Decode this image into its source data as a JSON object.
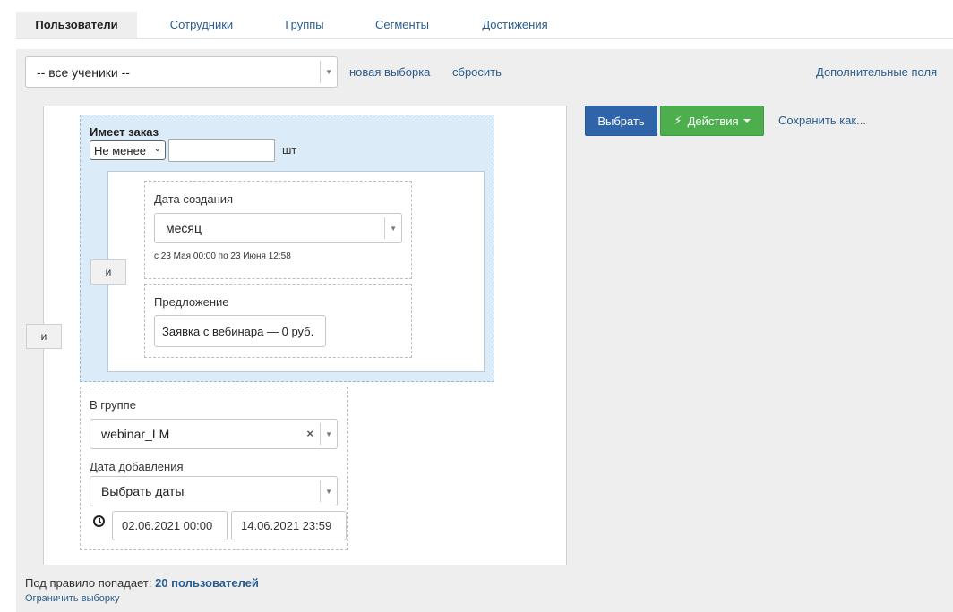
{
  "tabs": [
    {
      "label": "Пользователи",
      "active": true
    },
    {
      "label": "Сотрудники"
    },
    {
      "label": "Группы"
    },
    {
      "label": "Сегменты"
    },
    {
      "label": "Достижения"
    }
  ],
  "selection": {
    "value": "-- все ученики --",
    "new_label": "новая выборка",
    "reset_label": "сбросить",
    "extra_fields_label": "Дополнительные поля"
  },
  "rules": {
    "and_label": "и",
    "order": {
      "title": "Имеет заказ",
      "comparator": "Не менее",
      "count": "",
      "unit": "шт",
      "and_label": "и",
      "created": {
        "label": "Дата создания",
        "period": "месяц",
        "range_note": "с 23 Мая 00:00 по 23 Июня 12:58"
      },
      "offer": {
        "label": "Предложение",
        "value": "Заявка с вебинара — 0 руб."
      }
    },
    "group": {
      "label": "В группе",
      "value": "webinar_LM",
      "added_label": "Дата добавления",
      "added_select": "Выбрать даты",
      "date_from": "02.06.2021 00:00",
      "date_to": "14.06.2021 23:59"
    }
  },
  "actions": {
    "select_label": "Выбрать",
    "actions_label": "Действия",
    "save_as_label": "Сохранить как..."
  },
  "summary": {
    "prefix": "Под правило попадает:",
    "count": "20 пользователей",
    "limit_label": "Ограничить выборку"
  },
  "colors": {
    "primary": "#2f65a8",
    "success": "#4cae4c",
    "link": "#2a5d8f",
    "order_bg": "#dcebf8"
  }
}
